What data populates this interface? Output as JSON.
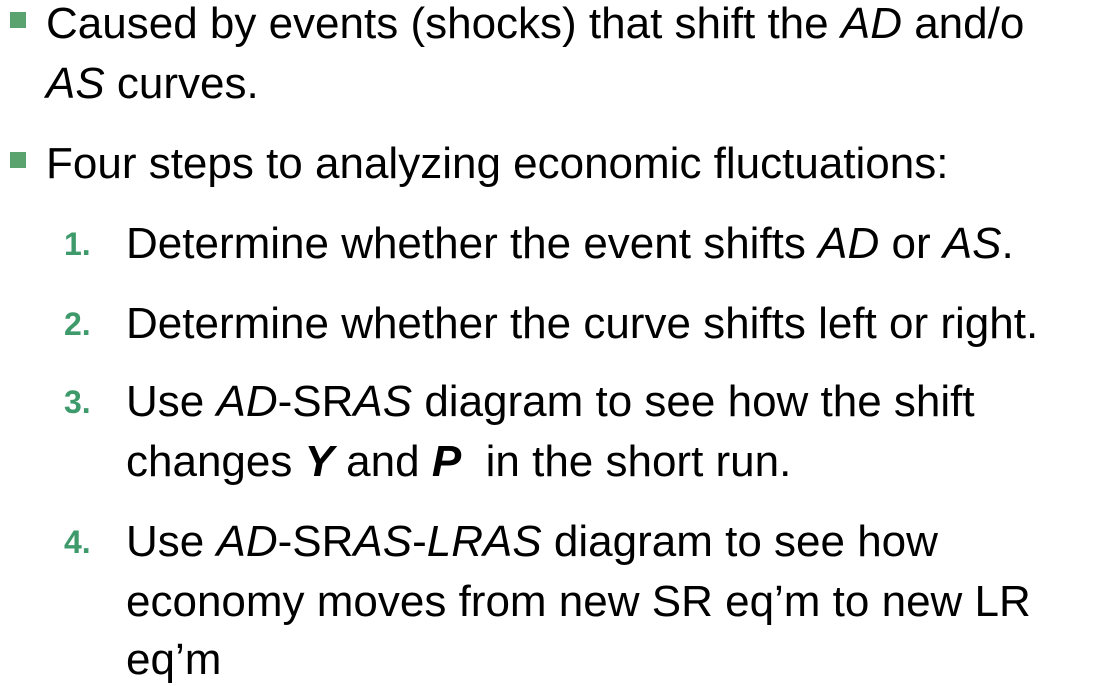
{
  "bullets": [
    {
      "line1_a": "Caused by events (shocks) that shift the ",
      "line1_i": "AD",
      "line1_b": " and/o",
      "line2_i": "AS",
      "line2_a": " curves."
    },
    {
      "line1": "Four steps to analyzing economic fluctuations:"
    }
  ],
  "steps": [
    {
      "num": "1.",
      "a": "Determine whether the event shifts ",
      "i1": "AD",
      "b": " or ",
      "i2": "AS",
      "c": "."
    },
    {
      "num": "2.",
      "text": "Determine whether the curve shifts left or right."
    },
    {
      "num": "3.",
      "a": "Use ",
      "i1": "AD",
      "b": "-SR",
      "i2": "AS",
      "c": " diagram to see how the shift",
      "l2a": "changes ",
      "l2b1": "Y",
      "l2c": " and ",
      "l2b2": "P",
      "l2d": "  in the short run."
    },
    {
      "num": "4.",
      "a": "Use ",
      "i1": "AD",
      "b": "-SR",
      "i2": "AS",
      "c": "-",
      "i3": "LRAS",
      "d": " diagram to see how",
      "l2": "economy moves from new SR eq’m to new LR",
      "l3": "eq’m"
    }
  ],
  "colors": {
    "bullet": "#5aa36f",
    "number": "#3e9a6b",
    "text": "#000000"
  }
}
